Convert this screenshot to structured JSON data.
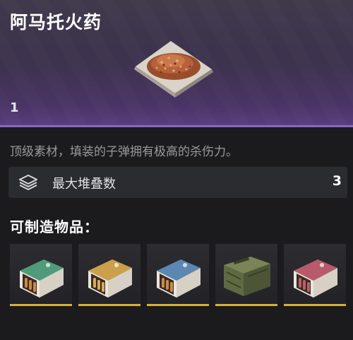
{
  "item": {
    "name": "阿马托火药",
    "quantity": "1",
    "description": "顶级素材，填装的子弹拥有极高的杀伤力。",
    "image_icon": "gunpowder-pile-icon",
    "rarity_color": "#8b67c4"
  },
  "stack": {
    "icon": "layers-icon",
    "label": "最大堆叠数",
    "value": "3"
  },
  "craftable": {
    "title": "可制造物品：",
    "items": [
      {
        "icon": "green-ammo-box-icon",
        "color": "#4f9a7a"
      },
      {
        "icon": "yellow-ammo-box-icon",
        "color": "#caa04a"
      },
      {
        "icon": "blue-ammo-box-icon",
        "color": "#5c87b3"
      },
      {
        "icon": "military-crate-icon",
        "color": "#5f6a43"
      },
      {
        "icon": "red-ammo-box-icon",
        "color": "#b85a6a"
      }
    ],
    "underline_color": "#d8b033"
  }
}
